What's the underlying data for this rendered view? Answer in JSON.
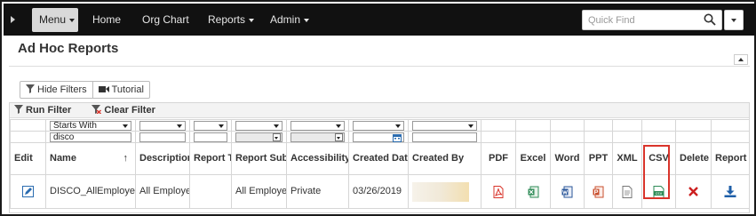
{
  "nav": {
    "menu_label": "Menu",
    "items": [
      {
        "label": "Home"
      },
      {
        "label": "Org Chart"
      },
      {
        "label": "Reports"
      },
      {
        "label": "Admin"
      }
    ],
    "quick_find_placeholder": "Quick Find"
  },
  "page": {
    "title": "Ad Hoc Reports"
  },
  "toolbar": {
    "hide_filters": "Hide Filters",
    "tutorial": "Tutorial",
    "run_filter": "Run Filter",
    "clear_filter": "Clear Filter"
  },
  "filters": {
    "name_operator": "Starts With",
    "name_value": "disco"
  },
  "table": {
    "columns": [
      "Edit",
      "Name",
      "Description",
      "Report Title",
      "Report Subject",
      "Accessibility",
      "Created Date",
      "Created By",
      "PDF",
      "Excel",
      "Word",
      "PPT",
      "XML",
      "CSV",
      "Delete",
      "Report Design"
    ],
    "sort_indicator": "↑",
    "rows": [
      {
        "name": "DISCO_AllEmployees",
        "description": "All Employees",
        "report_title": "",
        "report_subject": "All Employees",
        "accessibility": "Private",
        "created_date": "03/26/2019",
        "created_by": ""
      }
    ]
  },
  "colors": {
    "navbar": "#111111",
    "highlight": "#d9342b",
    "pdf": "#d9342b",
    "excel": "#2e8b57",
    "word": "#2b579a",
    "delete": "#cc1f1f",
    "design": "#1f5fa8"
  },
  "icons": {
    "edit": "pencil-icon",
    "pdf": "pdf-icon",
    "excel": "excel-icon",
    "word": "word-icon",
    "ppt": "powerpoint-icon",
    "xml": "xml-icon",
    "csv": "csv-icon",
    "delete": "delete-x-icon",
    "design": "download-arrow-icon"
  }
}
